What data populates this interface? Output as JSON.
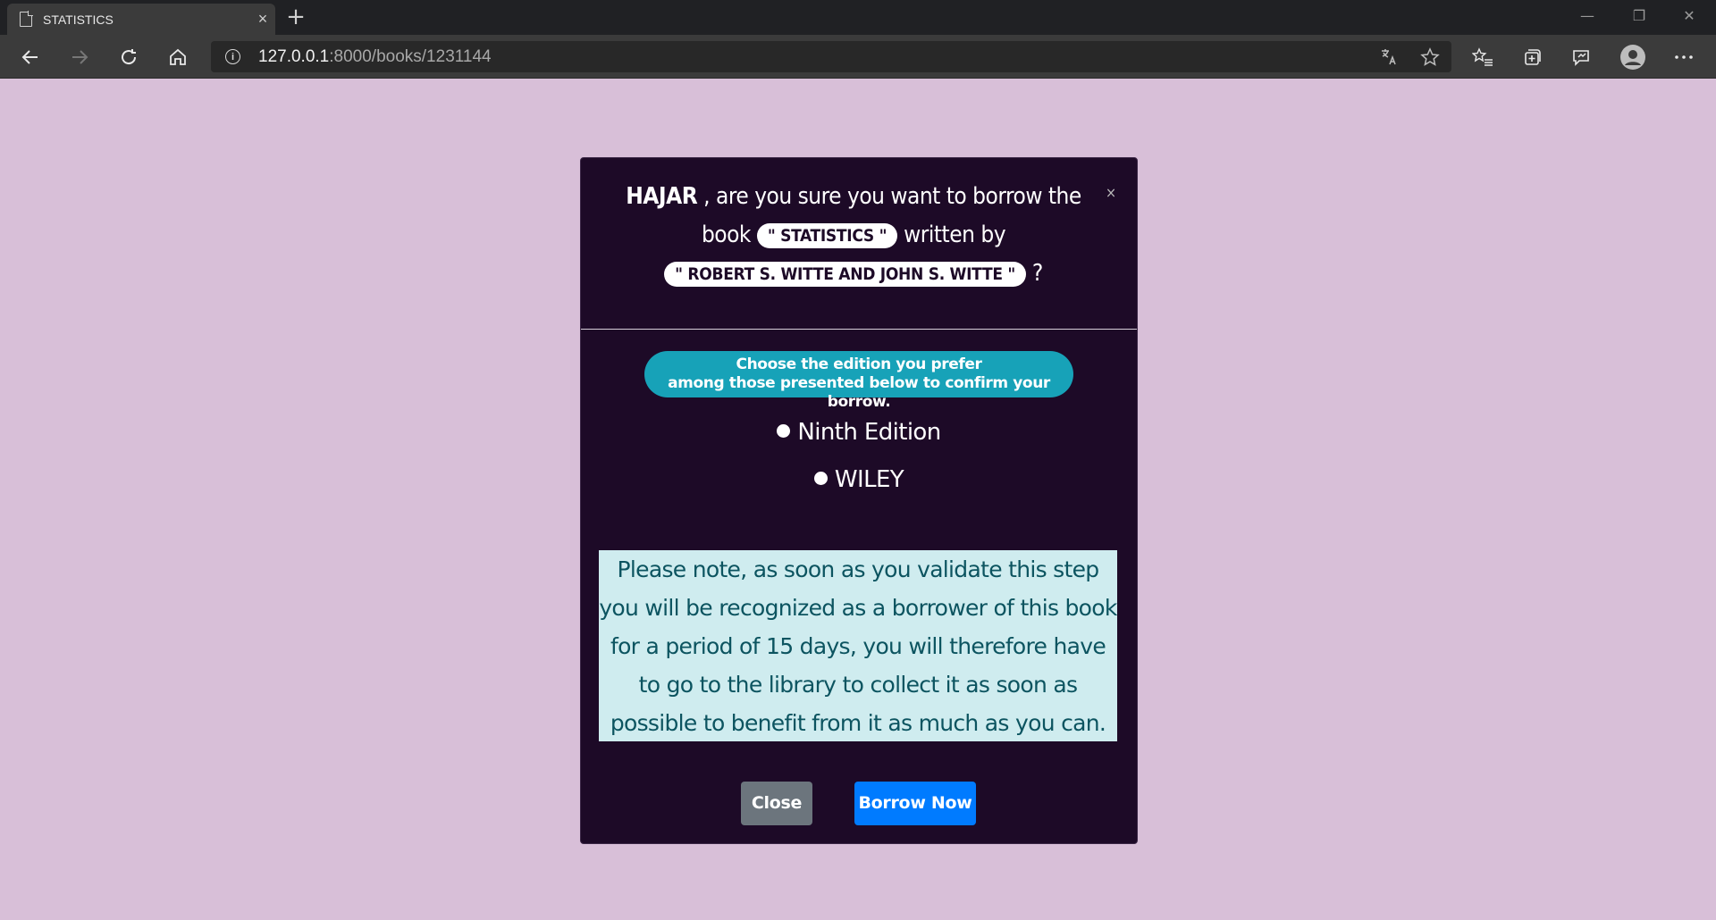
{
  "browser": {
    "tab_title": "STATISTICS",
    "tab_close": "×",
    "new_tab": "+",
    "url_host": "127.0.0.1",
    "url_path": ":8000/books/1231144",
    "window_controls": {
      "minimize": "—",
      "restore": "❐",
      "close": "✕"
    }
  },
  "modal": {
    "user": "HAJAR",
    "question_part1": ", are you sure you want to borrow the book",
    "book_title": "\" STATISTICS \"",
    "question_part2": "written by",
    "authors": "\" ROBERT S. WITTE AND JOHN S. WITTE \"",
    "question_mark": "?",
    "close_x": "×",
    "hint_line1": "Choose the edition you prefer",
    "hint_line2": "among those presented below to confirm your borrow.",
    "options": [
      "Ninth Edition",
      "WILEY"
    ],
    "notice": "Please note, as soon as you validate this step you will be recognized as a borrower of this book for a period of 15 days, you will therefore have to go to the library to collect it as soon as possible to benefit from it as much as you can.",
    "buttons": {
      "close": "Close",
      "borrow": "Borrow Now"
    }
  },
  "colors": {
    "page_bg": "#d8bfd8",
    "modal_bg": "#1d0a27",
    "hint_bg": "#17a2b8",
    "notice_bg": "#cfecef",
    "notice_text": "#0c5460",
    "close_btn": "#6c757d",
    "borrow_btn": "#007bff"
  }
}
